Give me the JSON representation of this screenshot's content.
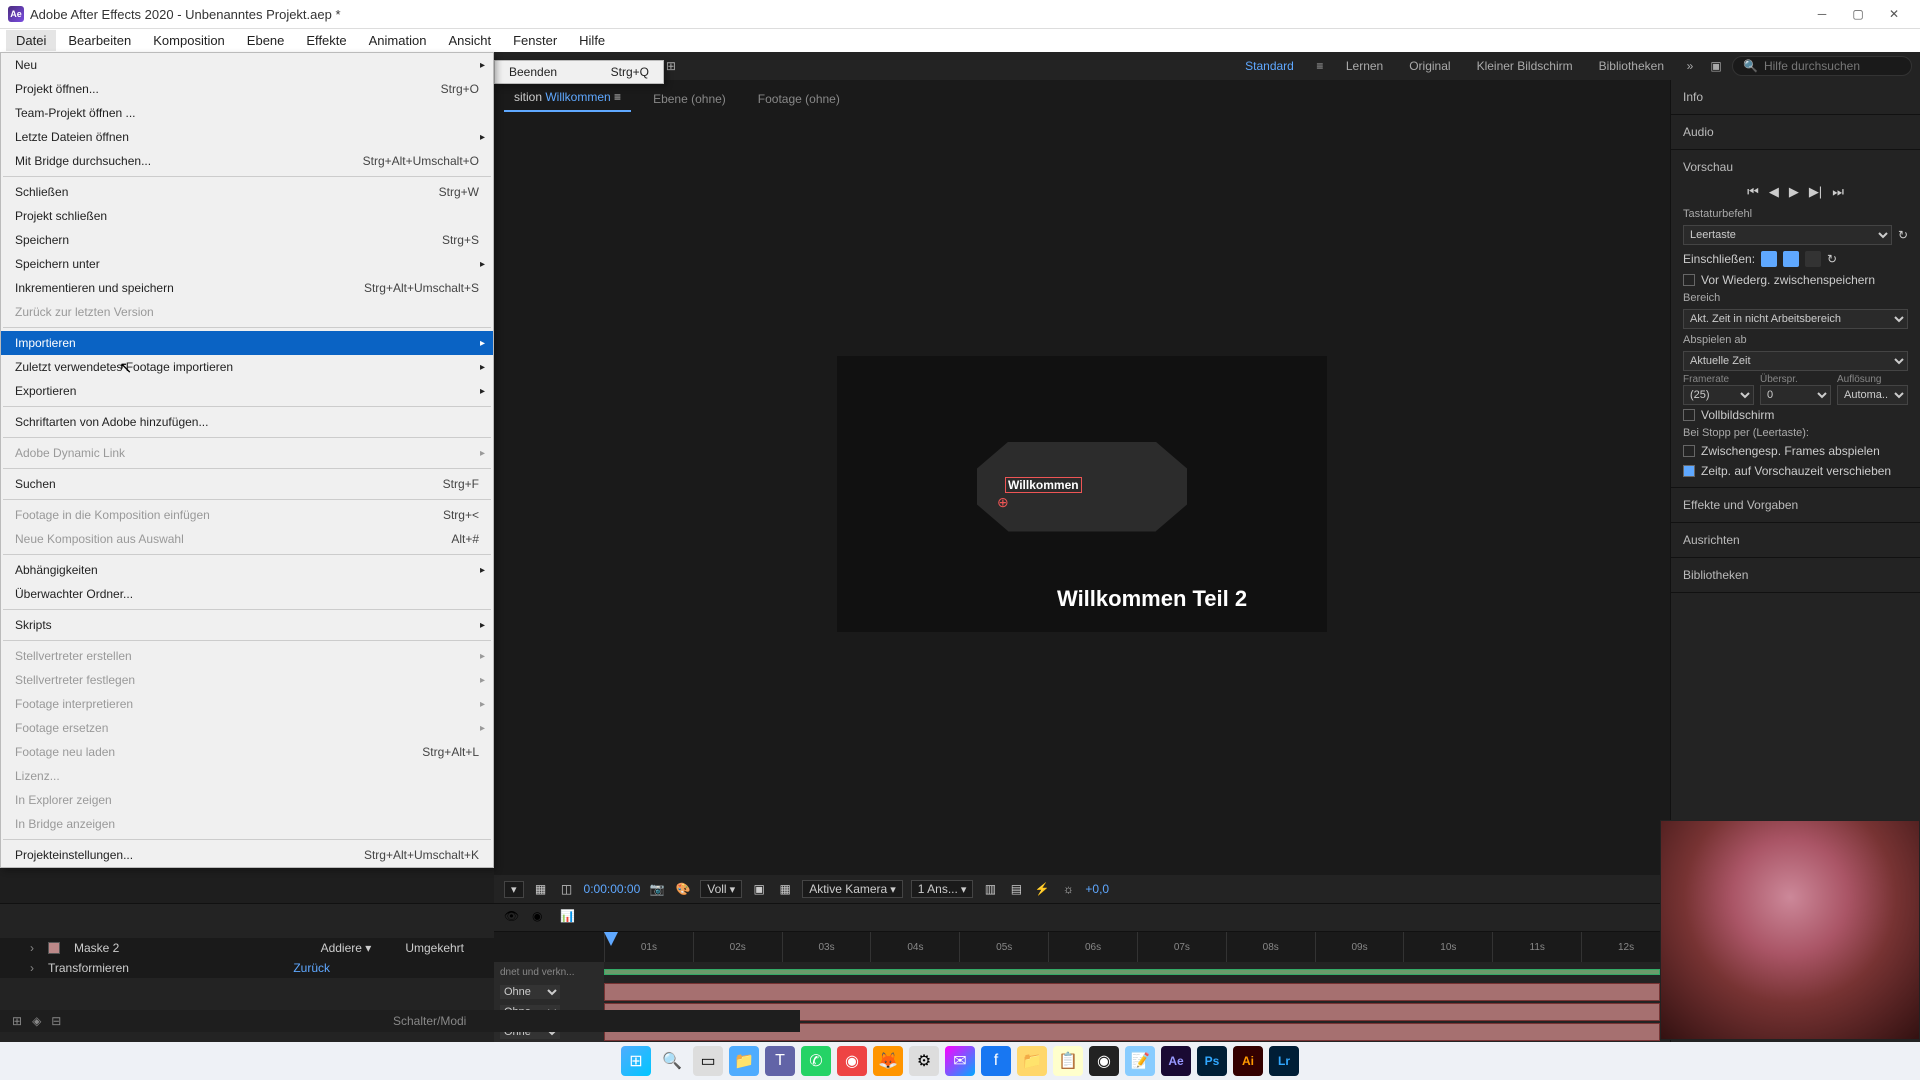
{
  "titlebar": {
    "app_abbrev": "Ae",
    "title": "Adobe After Effects 2020 - Unbenanntes Projekt.aep *"
  },
  "menubar": {
    "items": [
      "Datei",
      "Bearbeiten",
      "Komposition",
      "Ebene",
      "Effekte",
      "Animation",
      "Ansicht",
      "Fenster",
      "Hilfe"
    ]
  },
  "dropdown": {
    "items": [
      {
        "label": "Neu",
        "shortcut": "",
        "arrow": true
      },
      {
        "label": "Projekt öffnen...",
        "shortcut": "Strg+O"
      },
      {
        "label": "Team-Projekt öffnen ...",
        "shortcut": ""
      },
      {
        "label": "Letzte Dateien öffnen",
        "shortcut": "",
        "arrow": true
      },
      {
        "label": "Mit Bridge durchsuchen...",
        "shortcut": "Strg+Alt+Umschalt+O"
      },
      {
        "sep": true
      },
      {
        "label": "Schließen",
        "shortcut": "Strg+W"
      },
      {
        "label": "Projekt schließen",
        "shortcut": ""
      },
      {
        "label": "Speichern",
        "shortcut": "Strg+S"
      },
      {
        "label": "Speichern unter",
        "shortcut": "",
        "arrow": true
      },
      {
        "label": "Inkrementieren und speichern",
        "shortcut": "Strg+Alt+Umschalt+S"
      },
      {
        "label": "Zurück zur letzten Version",
        "shortcut": "",
        "disabled": true
      },
      {
        "sep": true
      },
      {
        "label": "Importieren",
        "shortcut": "",
        "arrow": true,
        "highlight": true
      },
      {
        "label": "Zuletzt verwendetes Footage importieren",
        "shortcut": "",
        "arrow": true
      },
      {
        "label": "Exportieren",
        "shortcut": "",
        "arrow": true
      },
      {
        "sep": true
      },
      {
        "label": "Schriftarten von Adobe hinzufügen...",
        "shortcut": ""
      },
      {
        "sep": true
      },
      {
        "label": "Adobe Dynamic Link",
        "shortcut": "",
        "arrow": true,
        "disabled": true
      },
      {
        "sep": true
      },
      {
        "label": "Suchen",
        "shortcut": "Strg+F"
      },
      {
        "sep": true
      },
      {
        "label": "Footage in die Komposition einfügen",
        "shortcut": "Strg+<",
        "disabled": true
      },
      {
        "label": "Neue Komposition aus Auswahl",
        "shortcut": "Alt+#",
        "disabled": true
      },
      {
        "sep": true
      },
      {
        "label": "Abhängigkeiten",
        "shortcut": "",
        "arrow": true
      },
      {
        "label": "Überwachter Ordner...",
        "shortcut": ""
      },
      {
        "sep": true
      },
      {
        "label": "Skripts",
        "shortcut": "",
        "arrow": true
      },
      {
        "sep": true
      },
      {
        "label": "Stellvertreter erstellen",
        "shortcut": "",
        "arrow": true,
        "disabled": true
      },
      {
        "label": "Stellvertreter festlegen",
        "shortcut": "",
        "arrow": true,
        "disabled": true
      },
      {
        "label": "Footage interpretieren",
        "shortcut": "",
        "arrow": true,
        "disabled": true
      },
      {
        "label": "Footage ersetzen",
        "shortcut": "",
        "arrow": true,
        "disabled": true
      },
      {
        "label": "Footage neu laden",
        "shortcut": "Strg+Alt+L",
        "disabled": true
      },
      {
        "label": "Lizenz...",
        "shortcut": "",
        "disabled": true
      },
      {
        "label": "In Explorer zeigen",
        "shortcut": "",
        "disabled": true
      },
      {
        "label": "In Bridge anzeigen",
        "shortcut": "",
        "disabled": true
      },
      {
        "sep": true
      },
      {
        "label": "Projekteinstellungen...",
        "shortcut": "Strg+Alt+Umschalt+K"
      }
    ]
  },
  "submenu": {
    "quit_label": "Beenden",
    "quit_shortcut": "Strg+Q"
  },
  "toolbar": {
    "snap_label": "Ausrichten",
    "workspaces": [
      "Standard",
      "Lernen",
      "Original",
      "Kleiner Bildschirm",
      "Bibliotheken"
    ],
    "search_placeholder": "Hilfe durchsuchen"
  },
  "comp_tabs": {
    "tab1_prefix": "sition",
    "tab1_name": "Willkommen",
    "tab2": "Ebene  (ohne)",
    "tab3": "Footage  (ohne)"
  },
  "canvas": {
    "text1": "Willkommen",
    "text2": "Willkommen Teil 2"
  },
  "preview_ctrls": {
    "time": "0:00:00:00",
    "res": "Voll",
    "camera": "Aktive Kamera",
    "views": "1 Ans...",
    "exposure": "+0,0"
  },
  "timeline": {
    "ticks": [
      "01s",
      "02s",
      "03s",
      "04s",
      "05s",
      "06s",
      "07s",
      "08s",
      "09s",
      "10s",
      "11s",
      "12s"
    ],
    "track_label_prefix": "dnet und verkn...",
    "mode_option": "Ohne"
  },
  "below_menu": {
    "mask_label": "Maske 2",
    "mask_mode": "Addiere",
    "mask_invert": "Umgekehrt",
    "transform_label": "Transformieren",
    "transform_reset": "Zurück"
  },
  "footer": {
    "mode_label": "Schalter/Modi"
  },
  "right": {
    "info": "Info",
    "audio": "Audio",
    "preview": "Vorschau",
    "shortcut": "Tastaturbefehl",
    "shortcut_val": "Leertaste",
    "include": "Einschließen:",
    "cache_before": "Vor Wiederg. zwischenspeichern",
    "range": "Bereich",
    "range_val": "Akt. Zeit in nicht Arbeitsbereich",
    "play_from": "Abspielen ab",
    "play_from_val": "Aktuelle Zeit",
    "framerate": "Framerate",
    "skip": "Überspr.",
    "resolution": "Auflösung",
    "fr_val": "(25)",
    "skip_val": "0",
    "res_val": "Automa...",
    "fullscreen": "Vollbildschirm",
    "stop_by": "Bei Stopp per (Leertaste):",
    "play_cached": "Zwischengesp. Frames abspielen",
    "move_time": "Zeitp. auf Vorschauzeit verschieben",
    "effects": "Effekte und Vorgaben",
    "align": "Ausrichten",
    "libraries": "Bibliotheken"
  }
}
